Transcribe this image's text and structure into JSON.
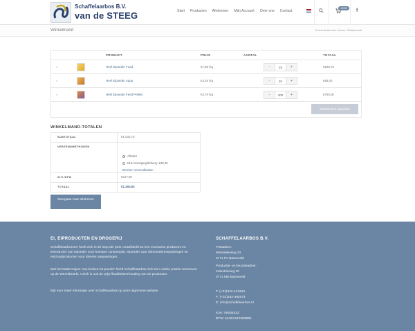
{
  "header": {
    "logo_line1": "Schaffelaarbos B.V.",
    "logo_line2": "van de STEEG",
    "nav": [
      "Start",
      "Producten",
      "Afrekenen",
      "Mijn Account",
      "Over ons",
      "Contact"
    ],
    "cart_badge": "1490€",
    "flag_colors": [
      "#ae1c28",
      "#ffffff",
      "#21468b"
    ]
  },
  "titlebar": {
    "title": "Winkelmand",
    "breadcrumb": "U bevindt zich hier: Home / Winkelmand"
  },
  "cart": {
    "headers": {
      "product": "PRODUCT",
      "price": "PRIJS",
      "qty": "AANTAL",
      "total": "TOTAAL"
    },
    "remove_symbol": "×",
    "minus": "-",
    "plus": "+",
    "rows": [
      {
        "name": "Heel Eipoeder Food",
        "price": "€7,95 /kg",
        "qty": "25",
        "total": "€198,75"
      },
      {
        "name": "Heel Eipoeder Aqua",
        "price": "€4,25 /kg",
        "qty": "20",
        "total": "€85,00"
      },
      {
        "name": "Heel Eipoeder Feed Pellets",
        "price": "€3,75 /kg",
        "qty": "200",
        "total": "€750,00"
      }
    ],
    "update_label": "Winkelmand bijwerken"
  },
  "totals": {
    "title": "WINKELMAND-TOTALEN",
    "subtotal_label": "SUBTOTAAL",
    "subtotal_value": "€1.033,75",
    "shipping_label": "VERZENDMETHODEN",
    "shipping_options": [
      "Afhalen",
      "DHL bezorging/delivery: €48,40"
    ],
    "calc_link": "Bereken Verzendkosten",
    "vat_label": "21% BTW",
    "vat_value": "€217,09",
    "total_label": "TOTAAL",
    "total_value": "€1.250,84",
    "checkout_label": "Doorgaan naar afrekenen"
  },
  "footer": {
    "left_title": "EI, EIPRODUCTEN EN DROGERIJ",
    "left_p1": "Schaffelaarbos BV heeft zich in de loop der jaren ontwikkeld tot een voorname producent en leverancier van eipoeder voor humane consumptie, eipoeder voor diervoedertoepassingen en eischaalproducten voor diverse toepassingen.",
    "left_p2": "Met het totale traject 'van breken tot poeder' heeft Schaffelaarbos zich een unieke positie verworven op de Wereldmarkt. Uniek is ook de prijs-/kwaliteitverhouding van de producten.",
    "left_p3": "Kijk voor meer informatie over Schaffelaarbos op onze algemene website.",
    "right_title": "SCHAFFELAARBOS B.V.",
    "right_lines": [
      "Postadres:",
      "Wesselseweg 23",
      "3771 PA Barneveld",
      "Productie- en bezoekadres:",
      "Industrieweg 20",
      "3771 MD Barneveld",
      "T: (+31)342-413344",
      "F: (+31)342-492573",
      "E: info@schaffelaarbos.nl",
      "KVK: 09035332",
      "BTW: NL001212382B01"
    ]
  }
}
